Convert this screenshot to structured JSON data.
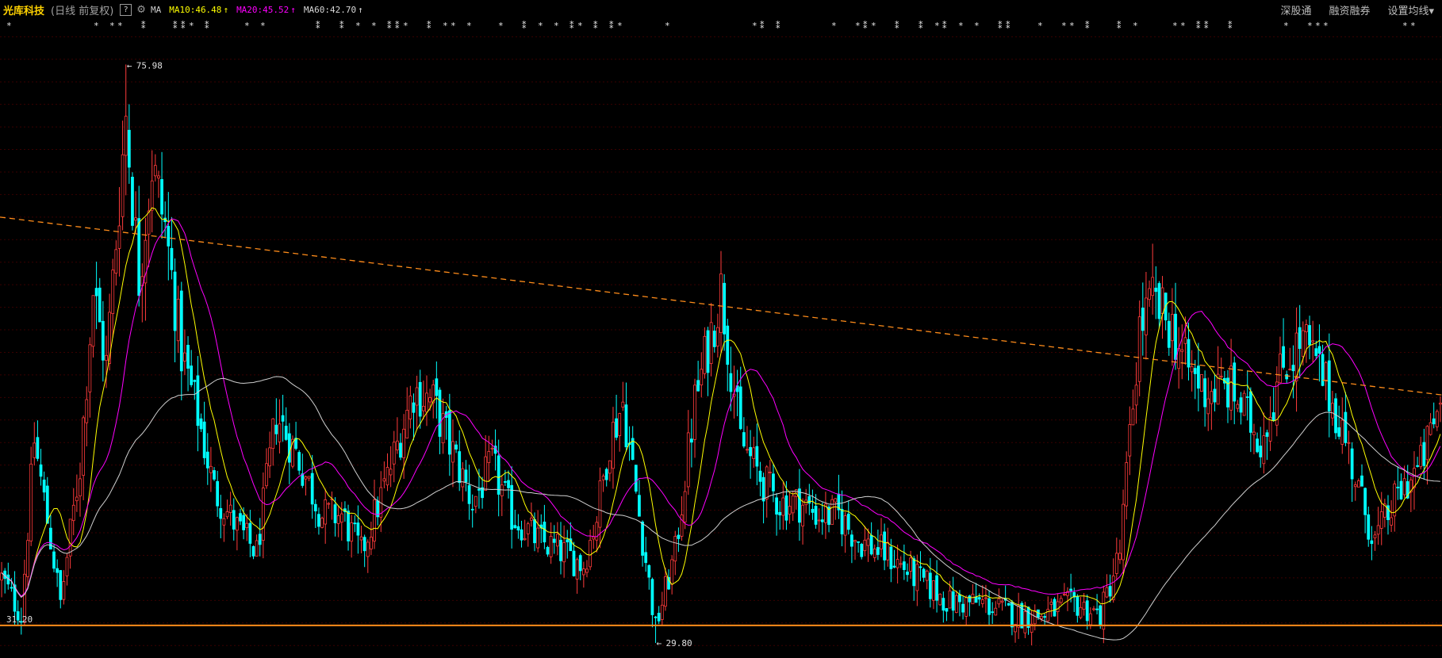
{
  "header": {
    "stock_name": "光库科技",
    "period_label": "(日线 前复权)",
    "help_icon_text": "?",
    "ma_label": "MA",
    "ma_items": [
      {
        "text": "MA10:46.48",
        "arrow": "↑",
        "color": "#ffff00"
      },
      {
        "text": "MA20:45.52",
        "arrow": "↑",
        "color": "#ff00ff"
      },
      {
        "text": "MA60:42.70",
        "arrow": "↑",
        "color": "#d8d8d8"
      }
    ],
    "right_menu": [
      "深股通",
      "融资融券",
      "设置均线▾"
    ]
  },
  "colors": {
    "up": "#ff3b3b",
    "down": "#00ffff",
    "ma10": "#ffff00",
    "ma20": "#ff00ff",
    "ma60": "#d0d0d0",
    "trendline": "#ff8c1a",
    "support": "#ff8c1a",
    "grid": "#3a0000"
  },
  "chart_data": {
    "type": "candlestick",
    "title": "",
    "ylim": [
      28.6,
      78.6
    ],
    "grid": true,
    "annotations": [
      {
        "label": "75.98",
        "value": 75.98,
        "index": 38
      },
      {
        "label": "29.80",
        "value": 29.8,
        "index": 200
      },
      {
        "label": "31.20",
        "value": 31.2
      }
    ],
    "support_line": {
      "value": 31.2
    },
    "trendline": [
      {
        "index": 0,
        "value": 63.8
      },
      {
        "index": 440,
        "value": 49.6
      }
    ],
    "keypoints": [
      [
        0,
        35
      ],
      [
        6,
        32
      ],
      [
        10,
        46
      ],
      [
        15,
        38
      ],
      [
        18,
        33
      ],
      [
        24,
        44
      ],
      [
        28,
        58
      ],
      [
        32,
        52
      ],
      [
        38,
        72
      ],
      [
        42,
        59
      ],
      [
        46,
        68
      ],
      [
        50,
        63
      ],
      [
        55,
        53
      ],
      [
        60,
        48
      ],
      [
        65,
        42
      ],
      [
        72,
        39
      ],
      [
        78,
        37
      ],
      [
        84,
        48
      ],
      [
        90,
        45
      ],
      [
        98,
        40
      ],
      [
        104,
        40
      ],
      [
        110,
        37
      ],
      [
        118,
        43
      ],
      [
        126,
        50
      ],
      [
        132,
        49
      ],
      [
        138,
        45
      ],
      [
        144,
        41
      ],
      [
        150,
        44
      ],
      [
        156,
        40
      ],
      [
        164,
        38
      ],
      [
        172,
        37
      ],
      [
        178,
        36
      ],
      [
        182,
        40
      ],
      [
        186,
        46
      ],
      [
        190,
        49
      ],
      [
        195,
        40
      ],
      [
        200,
        31
      ],
      [
        206,
        37
      ],
      [
        212,
        49
      ],
      [
        220,
        58
      ],
      [
        226,
        46
      ],
      [
        232,
        43
      ],
      [
        238,
        41
      ],
      [
        244,
        41
      ],
      [
        250,
        40
      ],
      [
        256,
        40
      ],
      [
        262,
        38
      ],
      [
        270,
        37
      ],
      [
        280,
        35
      ],
      [
        290,
        33
      ],
      [
        300,
        33
      ],
      [
        310,
        32
      ],
      [
        318,
        32
      ],
      [
        328,
        33
      ],
      [
        336,
        32
      ],
      [
        342,
        37
      ],
      [
        348,
        55
      ],
      [
        352,
        57
      ],
      [
        358,
        55
      ],
      [
        362,
        52
      ],
      [
        368,
        50
      ],
      [
        376,
        50
      ],
      [
        385,
        46
      ],
      [
        392,
        52
      ],
      [
        398,
        54
      ],
      [
        404,
        51
      ],
      [
        410,
        47
      ],
      [
        416,
        41
      ],
      [
        420,
        38
      ],
      [
        428,
        42
      ],
      [
        434,
        44
      ],
      [
        440,
        49
      ]
    ],
    "last": {
      "index": 440,
      "ma10": 46.48,
      "ma20": 45.52,
      "ma60": 42.7
    }
  }
}
